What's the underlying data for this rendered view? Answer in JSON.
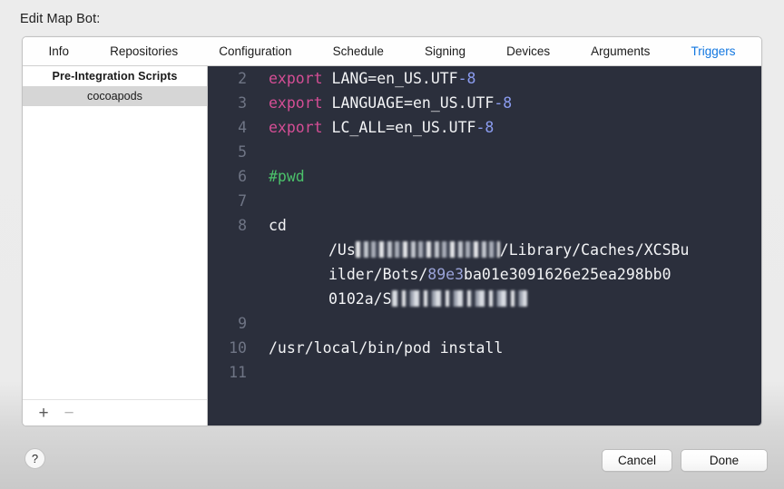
{
  "window": {
    "sheet_title": "Edit Map Bot:"
  },
  "tabs": [
    {
      "label": "Info",
      "active": false
    },
    {
      "label": "Repositories",
      "active": false
    },
    {
      "label": "Configuration",
      "active": false
    },
    {
      "label": "Schedule",
      "active": false
    },
    {
      "label": "Signing",
      "active": false
    },
    {
      "label": "Devices",
      "active": false
    },
    {
      "label": "Arguments",
      "active": false
    },
    {
      "label": "Triggers",
      "active": true
    }
  ],
  "script_list": {
    "group_header": "Pre-Integration Scripts",
    "items": [
      {
        "label": "cocoapods",
        "selected": true
      }
    ],
    "toolbar": {
      "add_label": "+",
      "remove_label": "−"
    }
  },
  "editor": {
    "lines": [
      {
        "number": "2",
        "segments": [
          {
            "text": "export",
            "type": "keyword"
          },
          {
            "text": " LANG=en_US.UTF",
            "type": "plain"
          },
          {
            "text": "-8",
            "type": "number"
          }
        ]
      },
      {
        "number": "3",
        "segments": [
          {
            "text": "export",
            "type": "keyword"
          },
          {
            "text": " LANGUAGE=en_US.UTF",
            "type": "plain"
          },
          {
            "text": "-8",
            "type": "number"
          }
        ]
      },
      {
        "number": "4",
        "segments": [
          {
            "text": "export",
            "type": "keyword"
          },
          {
            "text": " LC_ALL=en_US.UTF",
            "type": "plain"
          },
          {
            "text": "-8",
            "type": "number"
          }
        ]
      },
      {
        "number": "5",
        "segments": []
      },
      {
        "number": "6",
        "segments": [
          {
            "text": "#pwd",
            "type": "comment"
          }
        ]
      },
      {
        "number": "7",
        "segments": []
      },
      {
        "number": "8",
        "segments": [
          {
            "text": "cd",
            "type": "plain"
          }
        ]
      },
      {
        "number": "9",
        "segments": []
      },
      {
        "number": "10",
        "segments": [
          {
            "text": "/usr/local/bin/pod install",
            "type": "plain"
          }
        ]
      },
      {
        "number": "11",
        "segments": []
      }
    ],
    "wrapped_path": {
      "line1_prefix": "/Us",
      "line1_redacted": "ers/longusername",
      "line1_suffix": "/Library/Caches/XCSBu",
      "line2_prefix": "ilder/Bots/",
      "line2_highlight": "89e3",
      "line2_suffix": "ba01e3091626e25ea298bb0",
      "line3_prefix": "0102a/S",
      "line3_redacted": "ourceNameHidden"
    }
  },
  "footer": {
    "help_label": "?",
    "cancel_label": "Cancel",
    "done_label": "Done"
  }
}
